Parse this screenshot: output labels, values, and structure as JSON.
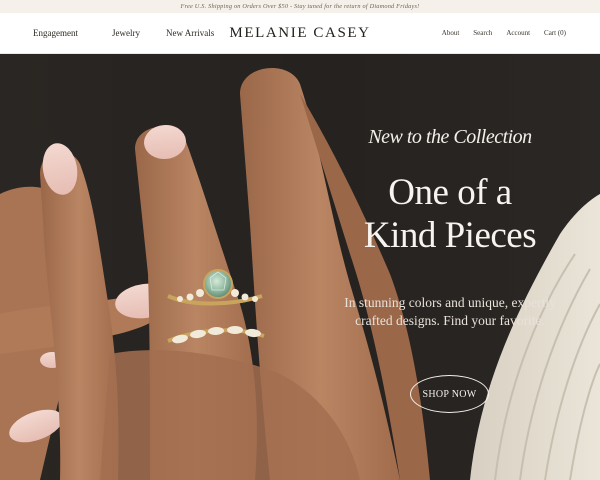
{
  "announcement": {
    "text": "Free U.S. Shipping on Orders Over $50 - Stay tuned for the return of Diamond Fridays!"
  },
  "header": {
    "nav_left": [
      "Engagement",
      "Jewelry",
      "New Arrivals"
    ],
    "logo": "MELANIE CASEY",
    "nav_right": [
      "About",
      "Search",
      "Account",
      "Cart (0)"
    ]
  },
  "hero": {
    "kicker": "New to the Collection",
    "headline_line1": "One of a",
    "headline_line2": "Kind Pieces",
    "subcopy_line1": "In stunning colors and unique, expertly",
    "subcopy_line2": "crafted designs. Find your favorite.",
    "cta_label": "SHOP NOW"
  },
  "colors": {
    "announcement_bg": "#f5f0e9",
    "hero_bg": "#2a2623",
    "hero_text": "#f7f3ee",
    "skin": "#b07a58",
    "gold": "#c9a45c",
    "gem": "#8fb7a0"
  }
}
